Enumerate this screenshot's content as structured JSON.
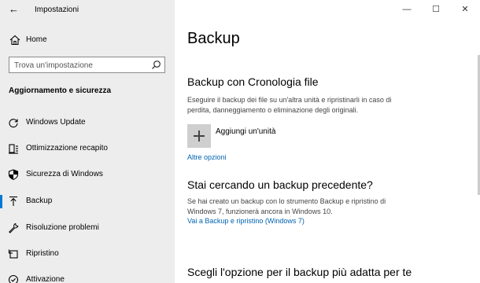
{
  "window": {
    "title": "Impostazioni",
    "controls": {
      "minimize": "—",
      "maximize": "☐",
      "close": "✕"
    }
  },
  "sidebar": {
    "back_icon": "back-arrow-icon",
    "home": {
      "label": "Home",
      "icon": "home-icon"
    },
    "search": {
      "placeholder": "Trova un'impostazione",
      "value": "",
      "icon": "search-icon"
    },
    "section_title": "Aggiornamento e sicurezza",
    "items": [
      {
        "label": "Windows Update",
        "icon": "refresh-icon",
        "active": false
      },
      {
        "label": "Ottimizzazione recapito",
        "icon": "delivery-icon",
        "active": false
      },
      {
        "label": "Sicurezza di Windows",
        "icon": "shield-icon",
        "active": false
      },
      {
        "label": "Backup",
        "icon": "upload-arrow-icon",
        "active": true
      },
      {
        "label": "Risoluzione problemi",
        "icon": "wrench-icon",
        "active": false
      },
      {
        "label": "Ripristino",
        "icon": "restore-icon",
        "active": false
      },
      {
        "label": "Attivazione",
        "icon": "check-circle-icon",
        "active": false
      }
    ]
  },
  "main": {
    "title": "Backup",
    "file_history": {
      "heading": "Backup con Cronologia file",
      "description": "Eseguire il backup dei file su un'altra unità e ripristinarli in caso di perdita, danneggiamento o eliminazione degli originali.",
      "add_drive_label": "Aggiungi un'unità",
      "more_options": "Altre opzioni"
    },
    "older_backup": {
      "heading": "Stai cercando un backup precedente?",
      "description": "Se hai creato un backup con lo strumento Backup e ripristino di Windows 7, funzionerà ancora in Windows 10.",
      "link": "Vai a Backup e ripristino (Windows 7)"
    },
    "choose_option": {
      "heading": "Scegli l'opzione per il backup più adatta per te"
    }
  },
  "colors": {
    "accent": "#0078d7",
    "link": "#0063b1",
    "sidebar_bg": "#ededed"
  }
}
